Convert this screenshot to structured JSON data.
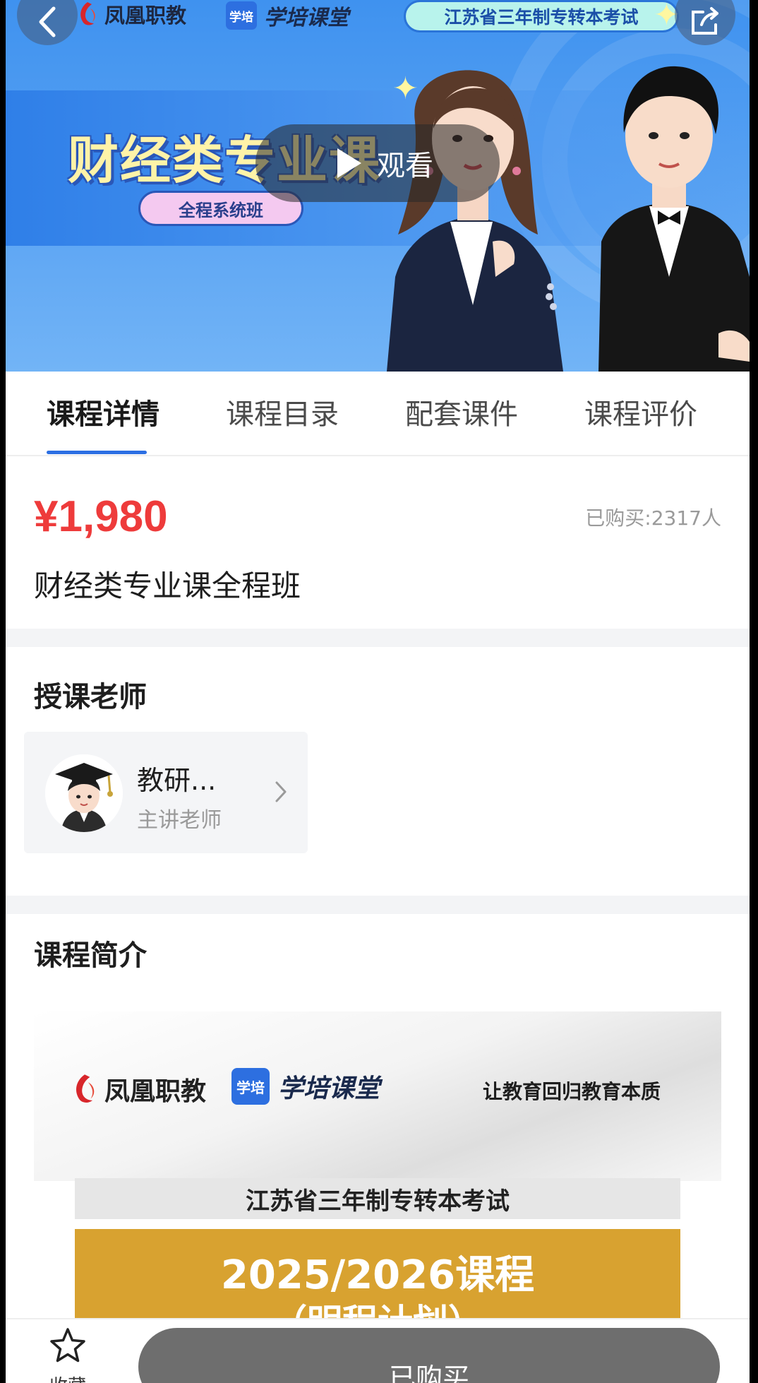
{
  "hero": {
    "brand_a": "凤凰职教",
    "brand_b_badge": "学培",
    "brand_b": "学培课堂",
    "exam_label": "江苏省三年制专转本考试",
    "title": "财经类专业课",
    "subtitle": "全程系统班",
    "play_label": "观看"
  },
  "tabs": [
    {
      "label": "课程详情",
      "active": true
    },
    {
      "label": "课程目录",
      "active": false
    },
    {
      "label": "配套课件",
      "active": false
    },
    {
      "label": "课程评价",
      "active": false
    }
  ],
  "course": {
    "price": "¥1,980",
    "sold": "已购买:2317人",
    "title": "财经类专业课全程班"
  },
  "teacher_section": {
    "title": "授课老师",
    "name": "教研...",
    "role": "主讲老师"
  },
  "intro_section": {
    "title": "课程简介",
    "poster": {
      "brand_a": "凤凰职教",
      "brand_b_badge": "学培",
      "brand_b": "学培课堂",
      "slogan": "让教育回归教育本质",
      "exam": "江苏省三年制专转本考试",
      "course_year": "2025/2026课程",
      "plan": "（明程计划）"
    }
  },
  "bottom_bar": {
    "favorite_label": "收藏",
    "buy_label": "已购买"
  },
  "colors": {
    "accent": "#2c6fe3",
    "price": "#ee3b3b",
    "gold": "#d8a230",
    "button_disabled": "#6e6e6e"
  },
  "icons": [
    "back-arrow-icon",
    "share-icon",
    "play-icon",
    "star-icon",
    "chevron-right-icon",
    "phoenix-logo-icon",
    "sparkle-icon"
  ]
}
